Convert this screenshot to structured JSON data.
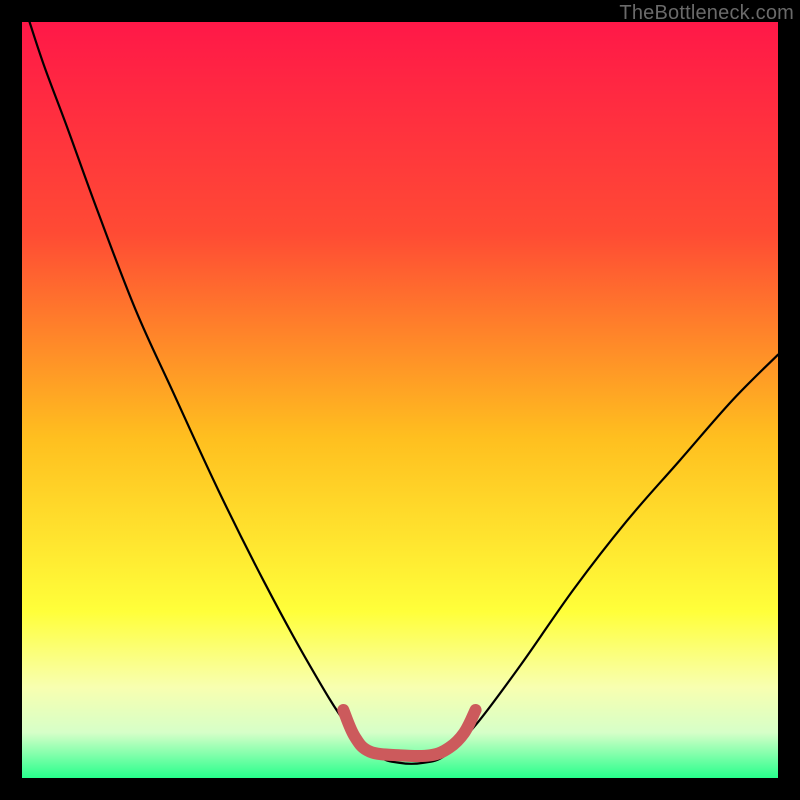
{
  "watermark": "TheBottleneck.com",
  "chart_data": {
    "type": "line",
    "title": "",
    "xlabel": "",
    "ylabel": "",
    "xlim": [
      0,
      100
    ],
    "ylim": [
      0,
      100
    ],
    "gradient_stops": [
      {
        "offset": 0,
        "color": "#ff1848"
      },
      {
        "offset": 28,
        "color": "#ff4b34"
      },
      {
        "offset": 55,
        "color": "#ffbf1f"
      },
      {
        "offset": 78,
        "color": "#ffff3a"
      },
      {
        "offset": 88,
        "color": "#f8ffb0"
      },
      {
        "offset": 94,
        "color": "#d6ffc8"
      },
      {
        "offset": 100,
        "color": "#27ff8c"
      }
    ],
    "series": [
      {
        "name": "bottleneck-curve",
        "color": "#000000",
        "width": 2.2,
        "points": [
          {
            "x": 1,
            "y": 100
          },
          {
            "x": 3,
            "y": 94
          },
          {
            "x": 6,
            "y": 86
          },
          {
            "x": 10,
            "y": 75
          },
          {
            "x": 15,
            "y": 62
          },
          {
            "x": 20,
            "y": 51
          },
          {
            "x": 26,
            "y": 38
          },
          {
            "x": 32,
            "y": 26
          },
          {
            "x": 38,
            "y": 15
          },
          {
            "x": 43,
            "y": 7
          },
          {
            "x": 47,
            "y": 3
          },
          {
            "x": 50,
            "y": 2
          },
          {
            "x": 53,
            "y": 2
          },
          {
            "x": 56,
            "y": 3
          },
          {
            "x": 60,
            "y": 7
          },
          {
            "x": 66,
            "y": 15
          },
          {
            "x": 73,
            "y": 25
          },
          {
            "x": 80,
            "y": 34
          },
          {
            "x": 87,
            "y": 42
          },
          {
            "x": 94,
            "y": 50
          },
          {
            "x": 100,
            "y": 56
          }
        ]
      },
      {
        "name": "optimal-band",
        "color": "#cc5a5c",
        "width": 12,
        "points": [
          {
            "x": 42.5,
            "y": 9
          },
          {
            "x": 44,
            "y": 5.5
          },
          {
            "x": 46,
            "y": 3.5
          },
          {
            "x": 50,
            "y": 3
          },
          {
            "x": 54,
            "y": 3
          },
          {
            "x": 56.5,
            "y": 4
          },
          {
            "x": 58.5,
            "y": 6
          },
          {
            "x": 60,
            "y": 9
          }
        ]
      }
    ]
  }
}
